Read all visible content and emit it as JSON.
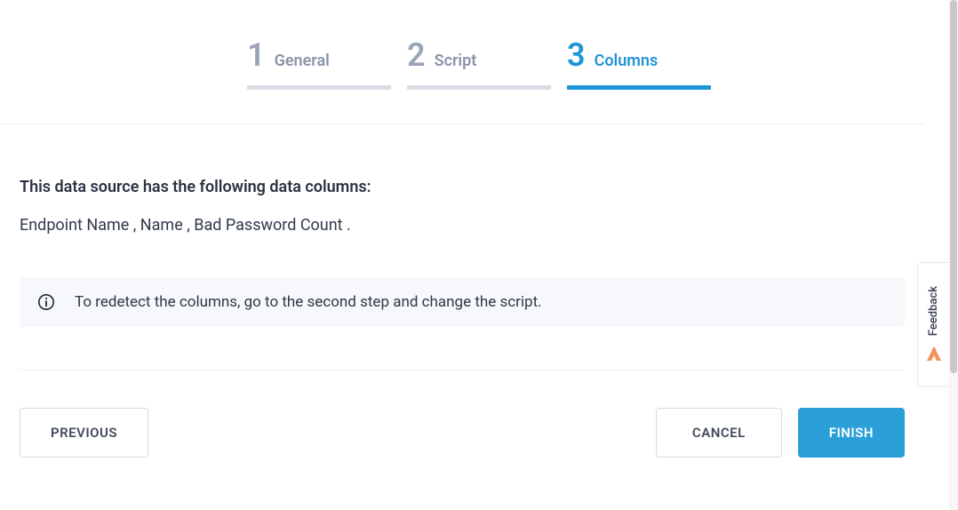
{
  "stepper": {
    "steps": [
      {
        "number": "1",
        "label": "General"
      },
      {
        "number": "2",
        "label": "Script"
      },
      {
        "number": "3",
        "label": "Columns"
      }
    ],
    "activeIndex": 2
  },
  "content": {
    "heading": "This data source has the following data columns:",
    "columns_text": "Endpoint Name , Name , Bad Password Count .",
    "info_text": "To redetect the columns, go to the second step and change the script."
  },
  "buttons": {
    "previous": "PREVIOUS",
    "cancel": "CANCEL",
    "finish": "FINISH"
  },
  "feedback": {
    "label": "Feedback"
  }
}
